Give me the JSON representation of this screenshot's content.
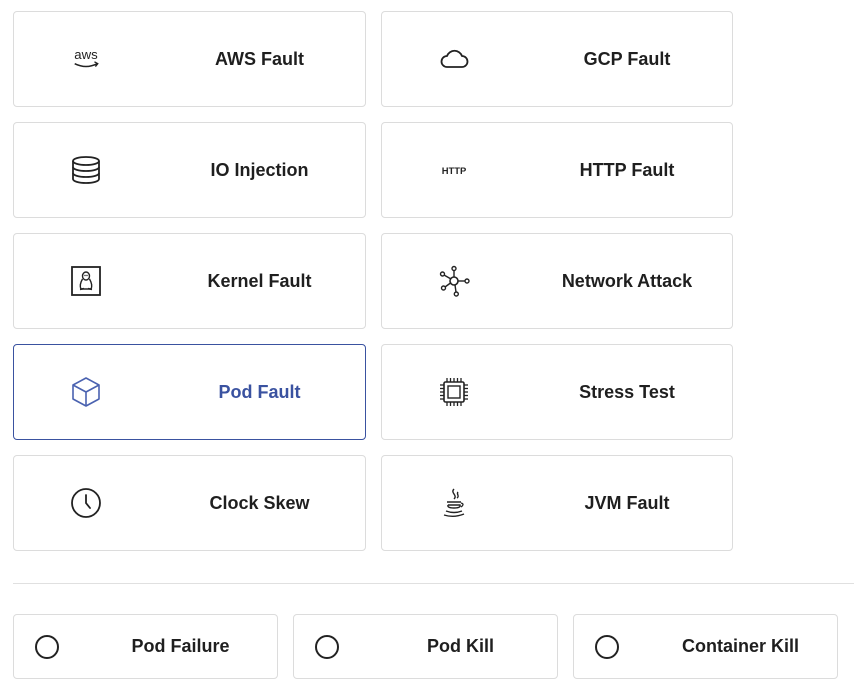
{
  "fault_types": [
    {
      "label": "AWS Fault",
      "icon": "aws-logo-icon"
    },
    {
      "label": "GCP Fault",
      "icon": "cloud-icon"
    },
    {
      "label": "IO Injection",
      "icon": "database-icon"
    },
    {
      "label": "HTTP Fault",
      "icon": "http-icon"
    },
    {
      "label": "Kernel Fault",
      "icon": "linux-penguin-icon"
    },
    {
      "label": "Network Attack",
      "icon": "network-hub-icon"
    },
    {
      "label": "Pod Fault",
      "icon": "cube-icon",
      "selected": true
    },
    {
      "label": "Stress Test",
      "icon": "cpu-chip-icon"
    },
    {
      "label": "Clock Skew",
      "icon": "clock-icon"
    },
    {
      "label": "JVM Fault",
      "icon": "java-coffee-icon"
    }
  ],
  "icon_text": {
    "aws": "aws",
    "http": "HTTP"
  },
  "pod_actions": [
    {
      "label": "Pod Failure",
      "checked": false
    },
    {
      "label": "Pod Kill",
      "checked": false
    },
    {
      "label": "Container Kill",
      "checked": false
    }
  ],
  "colors": {
    "selected_accent": "#3a52a0",
    "border": "#dcdcdc",
    "text": "#1f1f1f"
  }
}
